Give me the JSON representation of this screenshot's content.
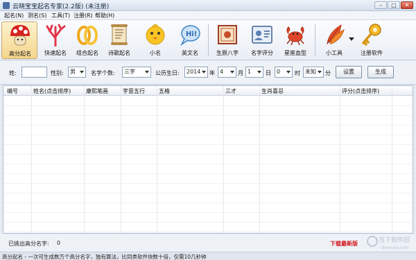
{
  "window": {
    "title": "云晓宝宝起名专家(2.2版) (未注册)",
    "minimize": "–",
    "maximize": "□",
    "close": "✕"
  },
  "menu": [
    "起名(N)",
    "测名(S)",
    "工具(T)",
    "注册(R)",
    "帮助(H)"
  ],
  "toolbar": [
    {
      "label": "高分起名",
      "icon": "mushroom-icon"
    },
    {
      "label": "快速起名",
      "icon": "coral-icon"
    },
    {
      "label": "组合起名",
      "icon": "ring-icon"
    },
    {
      "label": "诗歌起名",
      "icon": "scroll-icon"
    },
    {
      "label": "小名",
      "icon": "chick-icon"
    },
    {
      "label": "英文名",
      "icon": "hi-bubble-icon"
    },
    {
      "label": "生辰八字",
      "icon": "certificate-icon"
    },
    {
      "label": "名字评分",
      "icon": "id-card-icon"
    },
    {
      "label": "星座血型",
      "icon": "crab-icon"
    },
    {
      "label": "小工具",
      "icon": "feather-icon"
    },
    {
      "label": "注册软件",
      "icon": "key-icon"
    }
  ],
  "filters": {
    "surname_label": "姓:",
    "surname_value": "",
    "gender_label": "性别:",
    "gender_value": "男",
    "count_label": "名字个数:",
    "count_value": "三字",
    "date_label": "公历生日:",
    "year": "2014",
    "year_unit": "年",
    "month": "4",
    "month_unit": "月",
    "day": "1",
    "day_unit": "日",
    "hour": "0",
    "hour_unit": "时",
    "minute": "未知",
    "minute_unit": "分",
    "settings_button": "设置",
    "generate_button": "生成"
  },
  "table": {
    "columns": [
      "编号",
      "姓名(点击排序)",
      "康熙笔画",
      "字意五行",
      "五格",
      "三才",
      "生肖喜忌",
      "评分(点击排序)"
    ]
  },
  "result": {
    "label": "已挑出高分名字:",
    "count": "0",
    "download": "下载最新版"
  },
  "watermark": {
    "line1": "当下软件园",
    "line2": "downxia.com"
  },
  "statusbar": {
    "text": "高分起名 - 一次可生成数万个高分名字，独有算法，比同类软件快数十倍，仅需10几秒钟"
  },
  "colors": {
    "accent": "#d2141c",
    "titlebar": "#d5dfec",
    "background": "#e6ebf2"
  }
}
